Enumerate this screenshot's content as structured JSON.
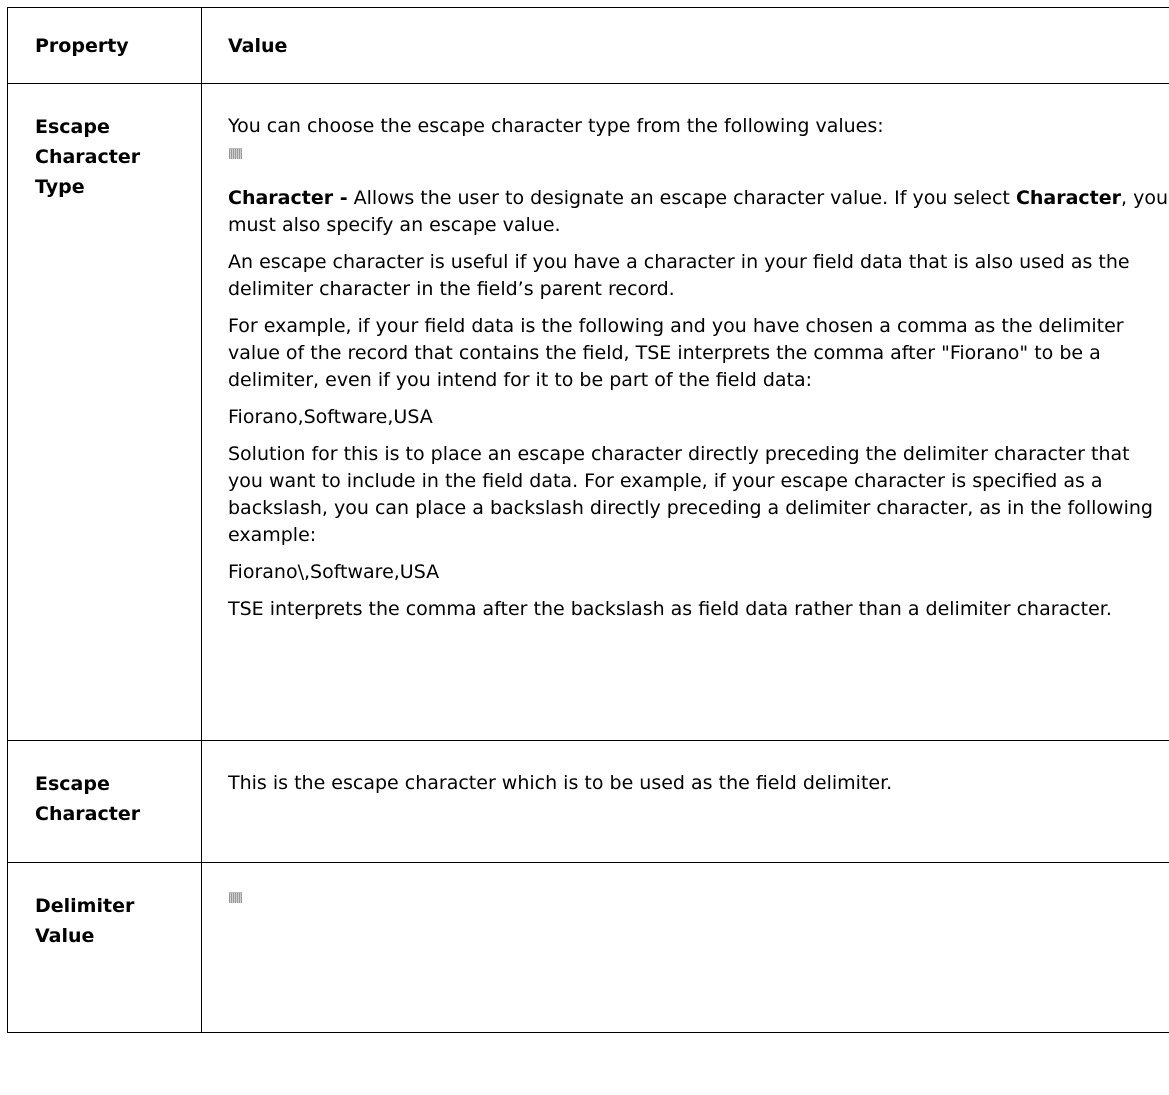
{
  "table": {
    "header": {
      "property": "Property",
      "value": "Value"
    },
    "rows": [
      {
        "property_line1": "Escape",
        "property_line2": "Character",
        "property_line3": "Type",
        "intro": "You can choose the escape character type from the following values:",
        "character_term": "Character -",
        "character_desc_1": " Allows the user to designate an escape character value. If you select ",
        "character_term_2": "Character",
        "character_desc_2": ", you must also specify an escape value.",
        "para_useful": "An escape character is useful if you have a character in your field data that is also used as the delimiter character in the field’s parent record.",
        "para_example": "For example, if your field data is the following and you have chosen a comma as the delimiter value of the record that contains the field, TSE interprets the comma after \"Fiorano\" to be a delimiter, even if you intend for it to be part of the field data:",
        "example_1": "Fiorano,Software,USA",
        "para_solution": "Solution for this is to place an escape character directly preceding the delimiter character that you want to include in the field data. For example, if your escape character is specified as a backslash, you can place a backslash directly preceding a delimiter character, as in the following example:",
        "example_2": "Fiorano\\,Software,USA",
        "para_interprets": "TSE interprets the comma after the backslash as field data rather than a delimiter character."
      },
      {
        "property_line1": "Escape",
        "property_line2": "Character",
        "value": "This is the escape character which is to be used as the field delimiter."
      },
      {
        "property_line1": "Delimiter",
        "property_line2": "Value"
      }
    ]
  }
}
